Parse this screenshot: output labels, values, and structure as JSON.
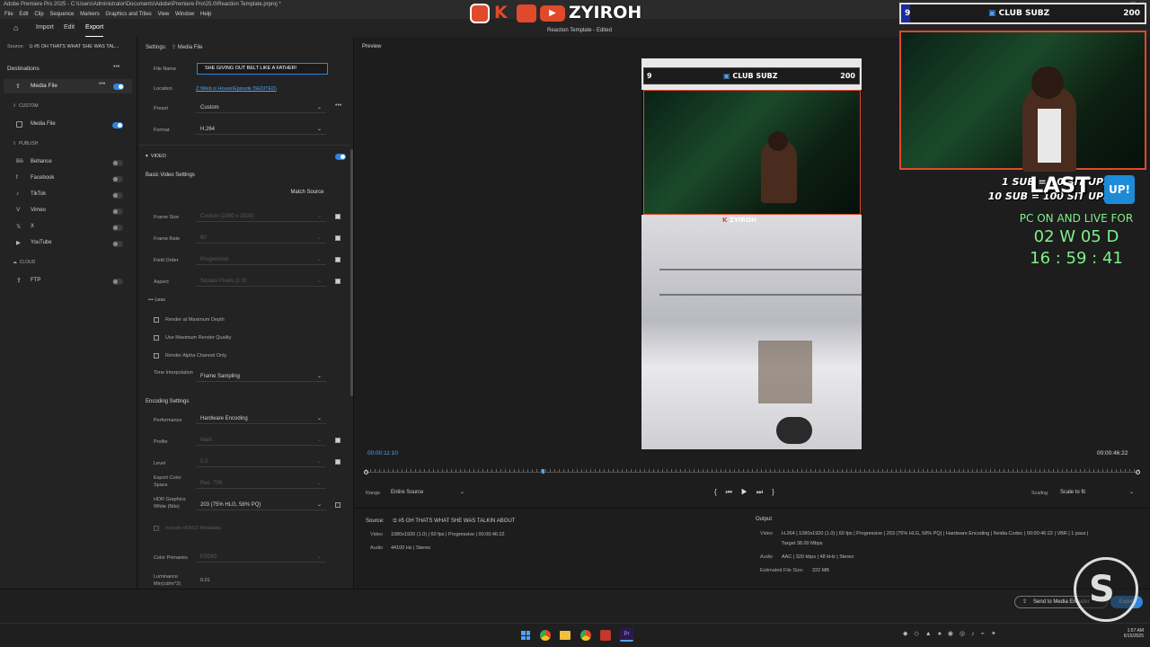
{
  "window": {
    "title": "Adobe Premiere Pro 2025 - C:\\Users\\Administrator\\Documents\\Adobe\\Premiere Pro\\25.0\\Reaction Template.prproj *",
    "doc_title": "Reaction Template",
    "doc_status": "Edited"
  },
  "menu": [
    "File",
    "Edit",
    "Clip",
    "Sequence",
    "Markers",
    "Graphics and Titles",
    "View",
    "Window",
    "Help"
  ],
  "modes": {
    "import": "Import",
    "edit": "Edit",
    "export": "Export"
  },
  "destinations": {
    "source_label": "Source:",
    "source_name": "#5 OH THATS WHAT SHE WAS TAL...",
    "title": "Destinations",
    "media_file": "Media File",
    "custom_header": "CUSTOM",
    "custom_media_file": "Media File",
    "publish_header": "PUBLISH",
    "publish": [
      "Behance",
      "Facebook",
      "TikTok",
      "Vimeo",
      "X",
      "YouTube"
    ],
    "cloud_header": "CLOUD",
    "ftp": "FTP"
  },
  "settings": {
    "title": "Settings:",
    "target": "Media File",
    "file_name_label": "File Name",
    "file_name": "SHE GIVING OUT BELT LIKE A FATHER!",
    "location_label": "Location",
    "location": "Z:\\Web is House\\Episode 5\\EDITED\\",
    "preset_label": "Preset",
    "preset": "Custom",
    "format_label": "Format",
    "format": "H.264",
    "video_header": "VIDEO",
    "basic_header": "Basic Video Settings",
    "match_source": "Match Source",
    "frame_size_label": "Frame Size",
    "frame_size": "Custom (1080 x 1920)",
    "frame_rate_label": "Frame Rate",
    "frame_rate": "60",
    "field_order_label": "Field Order",
    "field_order": "Progressive",
    "aspect_label": "Aspect",
    "aspect": "Square Pixels (1.0)",
    "less": "Less",
    "render_max_depth": "Render at Maximum Depth",
    "max_render_quality": "Use Maximum Render Quality",
    "render_alpha": "Render Alpha Channel Only",
    "time_interp_label": "Time Interpolation",
    "time_interp": "Frame Sampling",
    "encoding_header": "Encoding Settings",
    "performance_label": "Performance",
    "performance": "Hardware Encoding",
    "profile_label": "Profile",
    "profile": "Main",
    "level_label": "Level",
    "level": "5.2",
    "export_color_label": "Export Color Space",
    "export_color": "Rec. 709",
    "hdr_label": "HDR Graphics White (Nits)",
    "hdr": "203 (75% HLG, 58% PQ)",
    "include_hdr": "Include HDR10 Metadata",
    "color_primaries_label": "Color Primaries",
    "color_primaries": "P3D65",
    "luminance_label": "Luminance Min(cd/m^2)",
    "luminance": "0.01"
  },
  "preview": {
    "title": "Preview",
    "timecode_in": "00:00:11:10",
    "timecode_out": "00:00:46:22",
    "playhead_fraction": 0.228,
    "range_label": "Range",
    "range": "Entire Source",
    "scaling_label": "Scaling",
    "scaling": "Scale to fit"
  },
  "source_info": {
    "label": "Source:",
    "name": "#5 OH THATS WHAT SHE WAS TALKIN ABOUT",
    "video_label": "Video",
    "video": "1080x1920 (1.0)  |  60 fps  |  Progressive  |  00:00:46:22",
    "audio_label": "Audio",
    "audio": "44100 Hz  |  Stereo"
  },
  "output_info": {
    "label": "Output",
    "video_label": "Video",
    "video": "H.264  |  1080x1920 (1.0)  |  60 fps  |  Progressive  |  203 (75% HLG, 58% PQ)  |  Hardware Encoding  |  Nvidia Codec  |  00:00:46:22  |  VBR  |  1 pass  |",
    "target": "Target 38.00 Mbps",
    "audio_label": "Audio",
    "audio": "AAC  |  320 kbps  |  48 kHz  |  Stereo",
    "size_label": "Estimated File Size:",
    "size": "222 MB"
  },
  "footer": {
    "send_to_encoder": "Send to Media Encoder",
    "export": "Export"
  },
  "stream_overlay": {
    "brand": "ZYIROH",
    "sub_left": "9",
    "sub_name": "CLUB SUBZ",
    "sub_right": "200",
    "rule1": "1 SUB = 10 SIT UPS",
    "rule2": "10 SUB = 100 SIT UPS",
    "last_label": "LAST",
    "up_badge": "UP!",
    "live_label": "PC ON AND LIVE FOR",
    "live_days": "02 W 05 D",
    "live_time": "16 : 59 : 41"
  },
  "video_frame": {
    "sub_left": "9",
    "sub_name": "CLUB SUBZ",
    "sub_right": "200",
    "brand": "ZYIROH"
  },
  "clock": {
    "time": "1:57 AM",
    "date": "6/15/2025"
  },
  "colors": {
    "accent": "#2f86e0",
    "timecode": "#4fa3f5",
    "live_green": "#7ef08a",
    "overlay_red": "#e04a2a"
  }
}
